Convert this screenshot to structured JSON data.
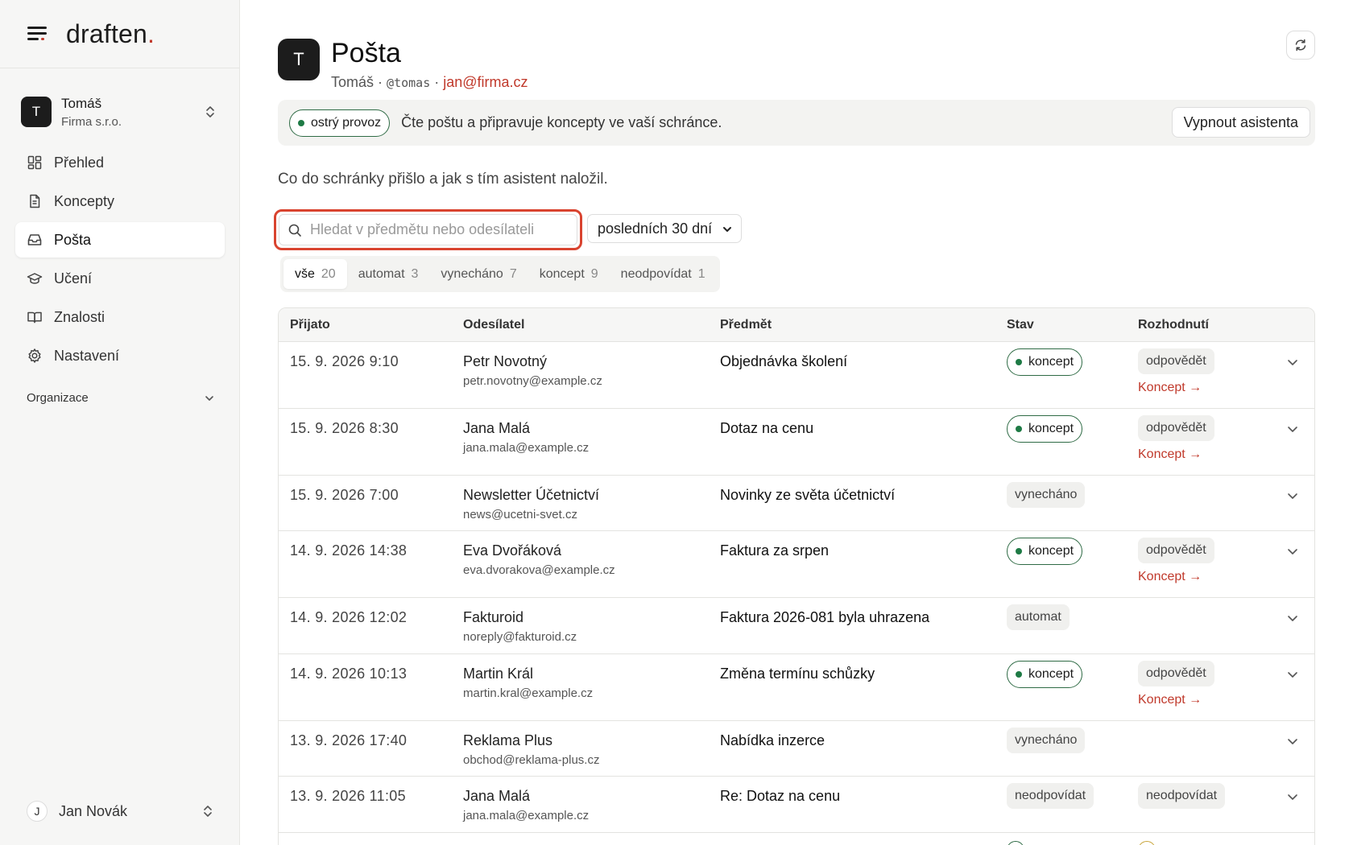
{
  "brand": {
    "logo_text": "draften",
    "logo_dot": "."
  },
  "account": {
    "initial": "T",
    "name": "Tomáš",
    "company": "Firma s.r.o."
  },
  "sidebar": {
    "items": [
      {
        "label": "Přehled"
      },
      {
        "label": "Koncepty"
      },
      {
        "label": "Pošta",
        "active": true
      },
      {
        "label": "Učení"
      },
      {
        "label": "Znalosti"
      },
      {
        "label": "Nastavení"
      }
    ],
    "org_label": "Organizace"
  },
  "user": {
    "initial": "J",
    "name": "Jan Novák"
  },
  "header": {
    "initial": "T",
    "title": "Pošta",
    "user_name": "Tomáš",
    "sep": "·",
    "handle": "@tomas",
    "email": "jan@firma.cz"
  },
  "banner": {
    "status": "ostrý provoz",
    "text": "Čte poštu a připravuje koncepty ve vaší schránce.",
    "button": "Vypnout asistenta"
  },
  "lede": "Co do schránky přišlo a jak s tím asistent naložil.",
  "search": {
    "placeholder": "Hledat v předmětu nebo odesílateli"
  },
  "period": {
    "selected": "posledních 30 dní"
  },
  "filters": [
    {
      "label": "vše",
      "count": "20",
      "active": true
    },
    {
      "label": "automat",
      "count": "3"
    },
    {
      "label": "vynecháno",
      "count": "7"
    },
    {
      "label": "koncept",
      "count": "9"
    },
    {
      "label": "neodpovídat",
      "count": "1"
    }
  ],
  "table": {
    "headers": {
      "received": "Přijato",
      "sender": "Odesílatel",
      "subject": "Předmět",
      "status": "Stav",
      "decision": "Rozhodnutí"
    },
    "rows": [
      {
        "date": "15. 9. 2026 9:10",
        "sender": "Petr Novotný",
        "email": "petr.novotny@example.cz",
        "subject": "Objednávka školení",
        "status": "koncept",
        "decision": "odpovědět",
        "link": "Koncept →"
      },
      {
        "date": "15. 9. 2026 8:30",
        "sender": "Jana Malá",
        "email": "jana.mala@example.cz",
        "subject": "Dotaz na cenu",
        "status": "koncept",
        "decision": "odpovědět",
        "link": "Koncept →"
      },
      {
        "date": "15. 9. 2026 7:00",
        "sender": "Newsletter Účetnictví",
        "email": "news@ucetni-svet.cz",
        "subject": "Novinky ze světa účetnictví",
        "status": "vynecháno",
        "decision": "",
        "link": ""
      },
      {
        "date": "14. 9. 2026 14:38",
        "sender": "Eva Dvořáková",
        "email": "eva.dvorakova@example.cz",
        "subject": "Faktura za srpen",
        "status": "koncept",
        "decision": "odpovědět",
        "link": "Koncept →"
      },
      {
        "date": "14. 9. 2026 12:02",
        "sender": "Fakturoid",
        "email": "noreply@fakturoid.cz",
        "subject": "Faktura 2026-081 byla uhrazena",
        "status": "automat",
        "decision": "",
        "link": ""
      },
      {
        "date": "14. 9. 2026 10:13",
        "sender": "Martin Král",
        "email": "martin.kral@example.cz",
        "subject": "Změna termínu schůzky",
        "status": "koncept",
        "decision": "odpovědět",
        "link": "Koncept →"
      },
      {
        "date": "13. 9. 2026 17:40",
        "sender": "Reklama Plus",
        "email": "obchod@reklama-plus.cz",
        "subject": "Nabídka inzerce",
        "status": "vynecháno",
        "decision": "",
        "link": ""
      },
      {
        "date": "13. 9. 2026 11:05",
        "sender": "Jana Malá",
        "email": "jana.mala@example.cz",
        "subject": "Re: Dotaz na cenu",
        "status": "neodpovídat",
        "decision": "neodpovídat",
        "link": ""
      }
    ]
  },
  "colors": {
    "accent": "#c0392b",
    "live_green": "#1e7a45",
    "search_highlight": "#d9432f"
  }
}
